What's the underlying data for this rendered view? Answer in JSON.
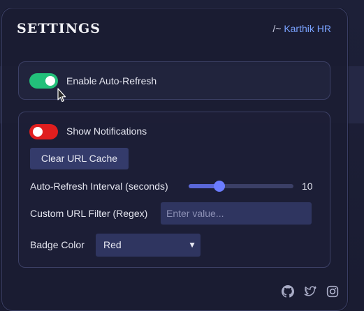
{
  "header": {
    "title": "SETTINGS",
    "user_prefix": "/~ ",
    "user_name": "Karthik HR"
  },
  "auto_refresh": {
    "label": "Enable Auto-Refresh",
    "enabled": true
  },
  "notifications": {
    "label": "Show Notifications",
    "enabled": false
  },
  "clear_cache": {
    "label": "Clear URL Cache"
  },
  "interval": {
    "label": "Auto-Refresh Interval (seconds)",
    "value": "10",
    "min": 1,
    "max": 60,
    "current": 10
  },
  "url_filter": {
    "label": "Custom URL Filter (Regex)",
    "placeholder": "Enter value..."
  },
  "badge_color": {
    "label": "Badge Color",
    "selected": "Red"
  },
  "footer": {
    "icons": [
      "github-icon",
      "twitter-icon",
      "instagram-icon"
    ]
  },
  "colors": {
    "toggle_on": "#22c07a",
    "toggle_off": "#e01e1e",
    "accent": "#7aa2ff",
    "slider_thumb": "#6b7cff"
  }
}
